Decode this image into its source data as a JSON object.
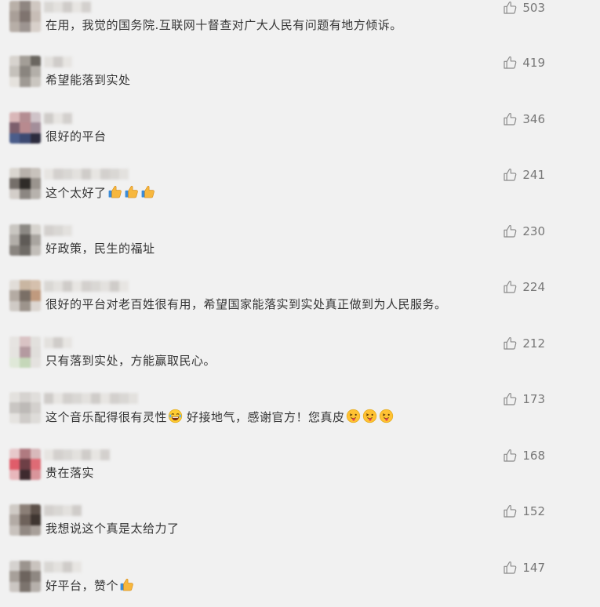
{
  "comments": [
    {
      "text": "在用，我觉的国务院.互联网十督查对广大人民有问题有地方倾诉。",
      "likes": "503",
      "emoji_after": [],
      "avatar": [
        "#b9b0a8",
        "#8f8681",
        "#cfc7c1",
        "#a99f98",
        "#7f746f",
        "#c7bdb6",
        "#b7aea7",
        "#9d9591",
        "#d8d0ca"
      ],
      "nick_blocks": 5
    },
    {
      "text": "希望能落到实处",
      "likes": "419",
      "emoji_after": [],
      "avatar": [
        "#d7d3ce",
        "#a39e97",
        "#6a6660",
        "#c5c1bb",
        "#8a857f",
        "#b3afa9",
        "#e5e2dd",
        "#9f9a94",
        "#cac6c0"
      ],
      "nick_blocks": 3
    },
    {
      "text": "很好的平台",
      "likes": "346",
      "emoji_after": [],
      "avatar": [
        "#d9b7b8",
        "#b48d92",
        "#cfc3c8",
        "#7d5f6d",
        "#b88a8f",
        "#a38e9a",
        "#4b5d8a",
        "#3d4a72",
        "#2c2c3e"
      ],
      "nick_blocks": 3
    },
    {
      "text": "这个太好了",
      "likes": "241",
      "emoji_after": [
        "thumbs-up",
        "thumbs-up",
        "thumbs-up"
      ],
      "avatar": [
        "#dad6d0",
        "#b8b1ab",
        "#c8c2bc",
        "#756f6a",
        "#2f2b28",
        "#9a948e",
        "#d3cec9",
        "#8c8782",
        "#b7b2ad"
      ],
      "nick_blocks": 9
    },
    {
      "text": "好政策，民生的福址",
      "likes": "230",
      "emoji_after": [],
      "avatar": [
        "#c9c6c1",
        "#8c8984",
        "#d6d3ce",
        "#b2aea9",
        "#5f5b57",
        "#a9a5a0",
        "#8a8580",
        "#6f6b66",
        "#c2beb9"
      ],
      "nick_blocks": 3
    },
    {
      "text": "很好的平台对老百姓很有用，希望国家能落实到实处真正做到为人民服务。",
      "likes": "224",
      "emoji_after": [],
      "avatar": [
        "#e1ddd8",
        "#c9b6a2",
        "#d5c0ad",
        "#b4aba3",
        "#7a6f66",
        "#c09a7e",
        "#cfcac5",
        "#9d948c",
        "#dcd6d1"
      ],
      "nick_blocks": 9
    },
    {
      "text": "只有落到实处，方能赢取民心。",
      "likes": "212",
      "emoji_after": [],
      "avatar": [
        "#e6e4e1",
        "#d9c3c4",
        "#e2e0dd",
        "#e5e3e0",
        "#b49aa0",
        "#e0dedb",
        "#dfe8d8",
        "#c5d7b9",
        "#e4e2df"
      ],
      "nick_blocks": 3
    },
    {
      "text": "这个音乐配得很有灵性",
      "likes": "173",
      "emoji_after": [
        "laughing"
      ],
      "text2": "好接地气，感谢官方！您真皮",
      "emoji_after2": [
        "tongue",
        "tongue",
        "tongue"
      ],
      "avatar": [
        "#e3e1de",
        "#d6d3d0",
        "#e0dedb",
        "#c9c6c3",
        "#bdbab7",
        "#d3d0cd",
        "#e5e3e0",
        "#cfccc9",
        "#dedcd9"
      ],
      "nick_blocks": 10
    },
    {
      "text": "贵在落实",
      "likes": "168",
      "emoji_after": [],
      "avatar": [
        "#e7c9cb",
        "#b07a80",
        "#d8b9bb",
        "#e05d6a",
        "#6e3f46",
        "#de6b75",
        "#e8b7bb",
        "#3e2a2e",
        "#d9959b"
      ],
      "nick_blocks": 7
    },
    {
      "text": "我想说这个真是太给力了",
      "likes": "152",
      "emoji_after": [],
      "avatar": [
        "#cfcac5",
        "#8b7f77",
        "#5d514a",
        "#b3aba5",
        "#6e625b",
        "#3f3631",
        "#c8c2bd",
        "#928983",
        "#a8a09a"
      ],
      "nick_blocks": 4
    },
    {
      "text": "好平台，赞个",
      "likes": "147",
      "emoji_after": [
        "thumbs-up"
      ],
      "avatar": [
        "#d5d2cf",
        "#9b948e",
        "#c9c3be",
        "#a7a09a",
        "#6d645e",
        "#8f8882",
        "#cbc6c2",
        "#7c746e",
        "#b6b0ab"
      ],
      "nick_blocks": 4
    }
  ],
  "icons": {
    "like": "thumbs-up-outline-icon"
  }
}
